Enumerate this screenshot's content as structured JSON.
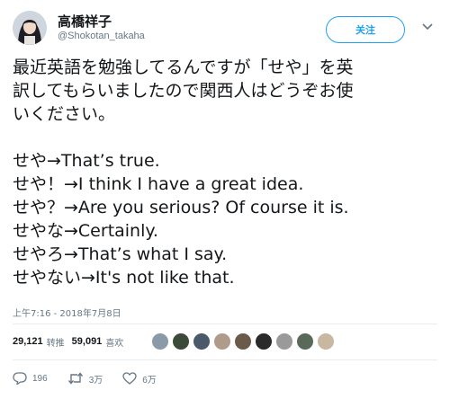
{
  "user": {
    "name": "高橋祥子",
    "handle": "@Shokotan_takaha"
  },
  "follow_label": "关注",
  "tweet": {
    "lines": [
      "最近英語を勉強してるんですが「せや」を英",
      "訳してもらいましたので関西人はどうぞお使",
      "いください。",
      "",
      "せや→That’s true.",
      "せや！→I think I have a great idea.",
      "せや？→Are you serious? Of course it is.",
      "せやな→Certainly.",
      "せやろ→That’s what I say.",
      "せやない→It's not like that."
    ]
  },
  "timestamp": "上午7:16 - 2018年7月8日",
  "stats": {
    "retweets": "29,121",
    "retweets_label": "转推",
    "likes": "59,091",
    "likes_label": "喜欢"
  },
  "likers_colors": [
    "#8a9aa8",
    "#3c4a3a",
    "#4a5a6a",
    "#b09a8a",
    "#6a5a4a",
    "#2a2a2a",
    "#9a9a9a",
    "#5a6a5a",
    "#c8b8a0"
  ],
  "actions": {
    "reply_count": "196",
    "retweet_count": "3万",
    "like_count": "6万"
  },
  "colors": {
    "accent": "#1da1f2",
    "muted": "#657786",
    "text": "#14171a"
  }
}
